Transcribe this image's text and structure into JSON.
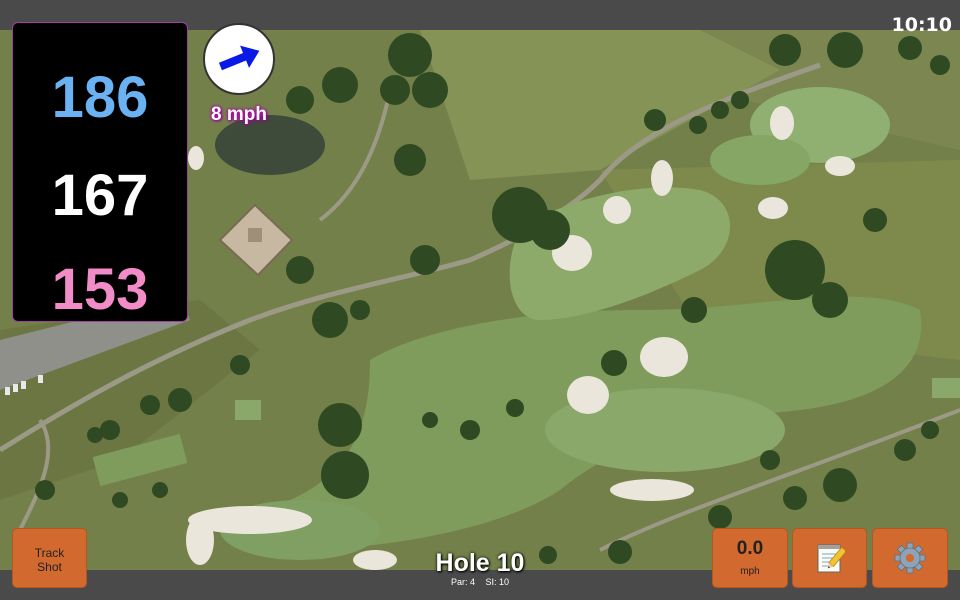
{
  "status_bar": {
    "time": "10:10"
  },
  "distances": {
    "back": "186",
    "middle": "167",
    "front": "153",
    "colors": {
      "back": "#6bb2f2",
      "middle": "#ffffff",
      "front": "#f28cc8"
    }
  },
  "wind": {
    "speed_label": "8 mph",
    "direction_icon": "arrow-east-northeast-icon",
    "arrow_color": "#0a1ae6"
  },
  "hole": {
    "title": "Hole 10",
    "par_label": "Par: 4",
    "si_label": "SI: 10"
  },
  "buttons": {
    "track_shot_line1": "Track",
    "track_shot_line2": "Shot",
    "speed_value": "0.0",
    "speed_unit": "mph",
    "notes_icon": "notepad-icon",
    "settings_icon": "gear-icon",
    "accent": "#d2692f"
  },
  "map": {
    "type": "satellite-aerial-golf-hole"
  }
}
